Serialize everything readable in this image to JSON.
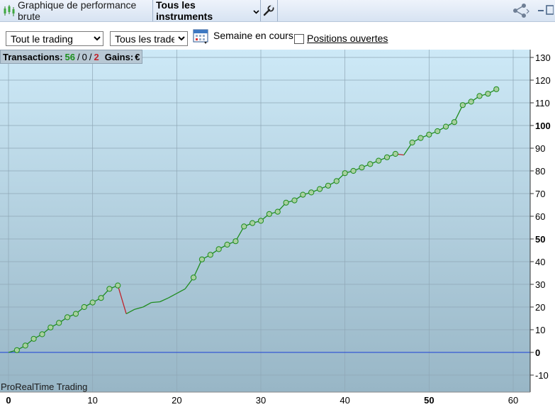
{
  "toolbar": {
    "title": "Graphique de performance brute",
    "instruments_label": "Tous les instruments",
    "icons": [
      "candlestick-icon",
      "chevron-down-icon",
      "wrench-icon",
      "share-icon",
      "window-icon"
    ]
  },
  "controls": {
    "period_select": "Tout le trading",
    "trades_select": "Tous les trades",
    "calendar_icon": "calendar-icon",
    "week_label": "Semaine en cours",
    "open_positions_label": "Positions ouvertes",
    "open_positions_checked": false
  },
  "stats": {
    "label": "Transactions:",
    "wins": "56",
    "sep1": "/",
    "neutral": "0",
    "sep2": "/",
    "losses": "2",
    "gains_label": "Gains:",
    "gains_value": "€"
  },
  "watermark": "ProRealTime Trading",
  "colors": {
    "up_line": "#1f8c1f",
    "down_line": "#c0232b",
    "zero_line": "#1a3fd6",
    "marker_fill": "#a8d0a0",
    "losses_text": "#c0232b",
    "wins_text": "#1b8f1b"
  },
  "chart_data": {
    "type": "line",
    "xlim": [
      0,
      62
    ],
    "ylim": [
      -18,
      133
    ],
    "grid": true,
    "x_ticks": [
      "0",
      "10",
      "20",
      "30",
      "40",
      "50",
      "60"
    ],
    "x_ticks_bold": [
      "0",
      "50"
    ],
    "y_ticks": [
      "130",
      "120",
      "110",
      "100",
      "90",
      "80",
      "70",
      "60",
      "50",
      "40",
      "30",
      "20",
      "10",
      "0",
      "-10"
    ],
    "y_ticks_bold": [
      "100",
      "50",
      "0"
    ],
    "series": [
      {
        "x": [
          0,
          1,
          2,
          3,
          4,
          5,
          6,
          7,
          8,
          9,
          10,
          11,
          12,
          13,
          14,
          15,
          16,
          17,
          18,
          19,
          20,
          21,
          22,
          23,
          24,
          25,
          26,
          27,
          28,
          29,
          30,
          31,
          32,
          33,
          34,
          35,
          36,
          37,
          38,
          39,
          40,
          41,
          42,
          43,
          44,
          45,
          46,
          47,
          48,
          49,
          50,
          51,
          52,
          53,
          54,
          55,
          56,
          57,
          58
        ],
        "y": [
          0,
          1,
          3,
          6,
          8,
          11,
          13,
          15.5,
          17,
          20,
          22,
          24,
          28,
          29.5,
          17,
          19,
          20,
          22,
          22.3,
          24,
          26,
          28,
          33,
          41,
          43,
          45.5,
          47.5,
          49,
          55.5,
          57,
          58,
          61,
          62,
          66,
          67,
          69.5,
          70.5,
          72,
          73.5,
          75.5,
          79,
          80,
          81.5,
          83,
          84.5,
          86,
          87.5,
          87,
          92.5,
          94.5,
          96,
          97.5,
          99.5,
          101.5,
          109,
          110.5,
          113,
          114,
          116
        ],
        "markers": [
          false,
          true,
          true,
          true,
          true,
          true,
          true,
          true,
          true,
          true,
          true,
          true,
          true,
          true,
          false,
          false,
          false,
          false,
          false,
          false,
          false,
          false,
          true,
          true,
          true,
          true,
          true,
          true,
          true,
          true,
          true,
          true,
          true,
          true,
          true,
          true,
          true,
          true,
          true,
          true,
          true,
          true,
          true,
          true,
          true,
          true,
          true,
          false,
          true,
          true,
          true,
          true,
          true,
          true,
          true,
          true,
          true,
          true,
          true
        ],
        "loss_segments": [
          13,
          46
        ]
      }
    ]
  }
}
